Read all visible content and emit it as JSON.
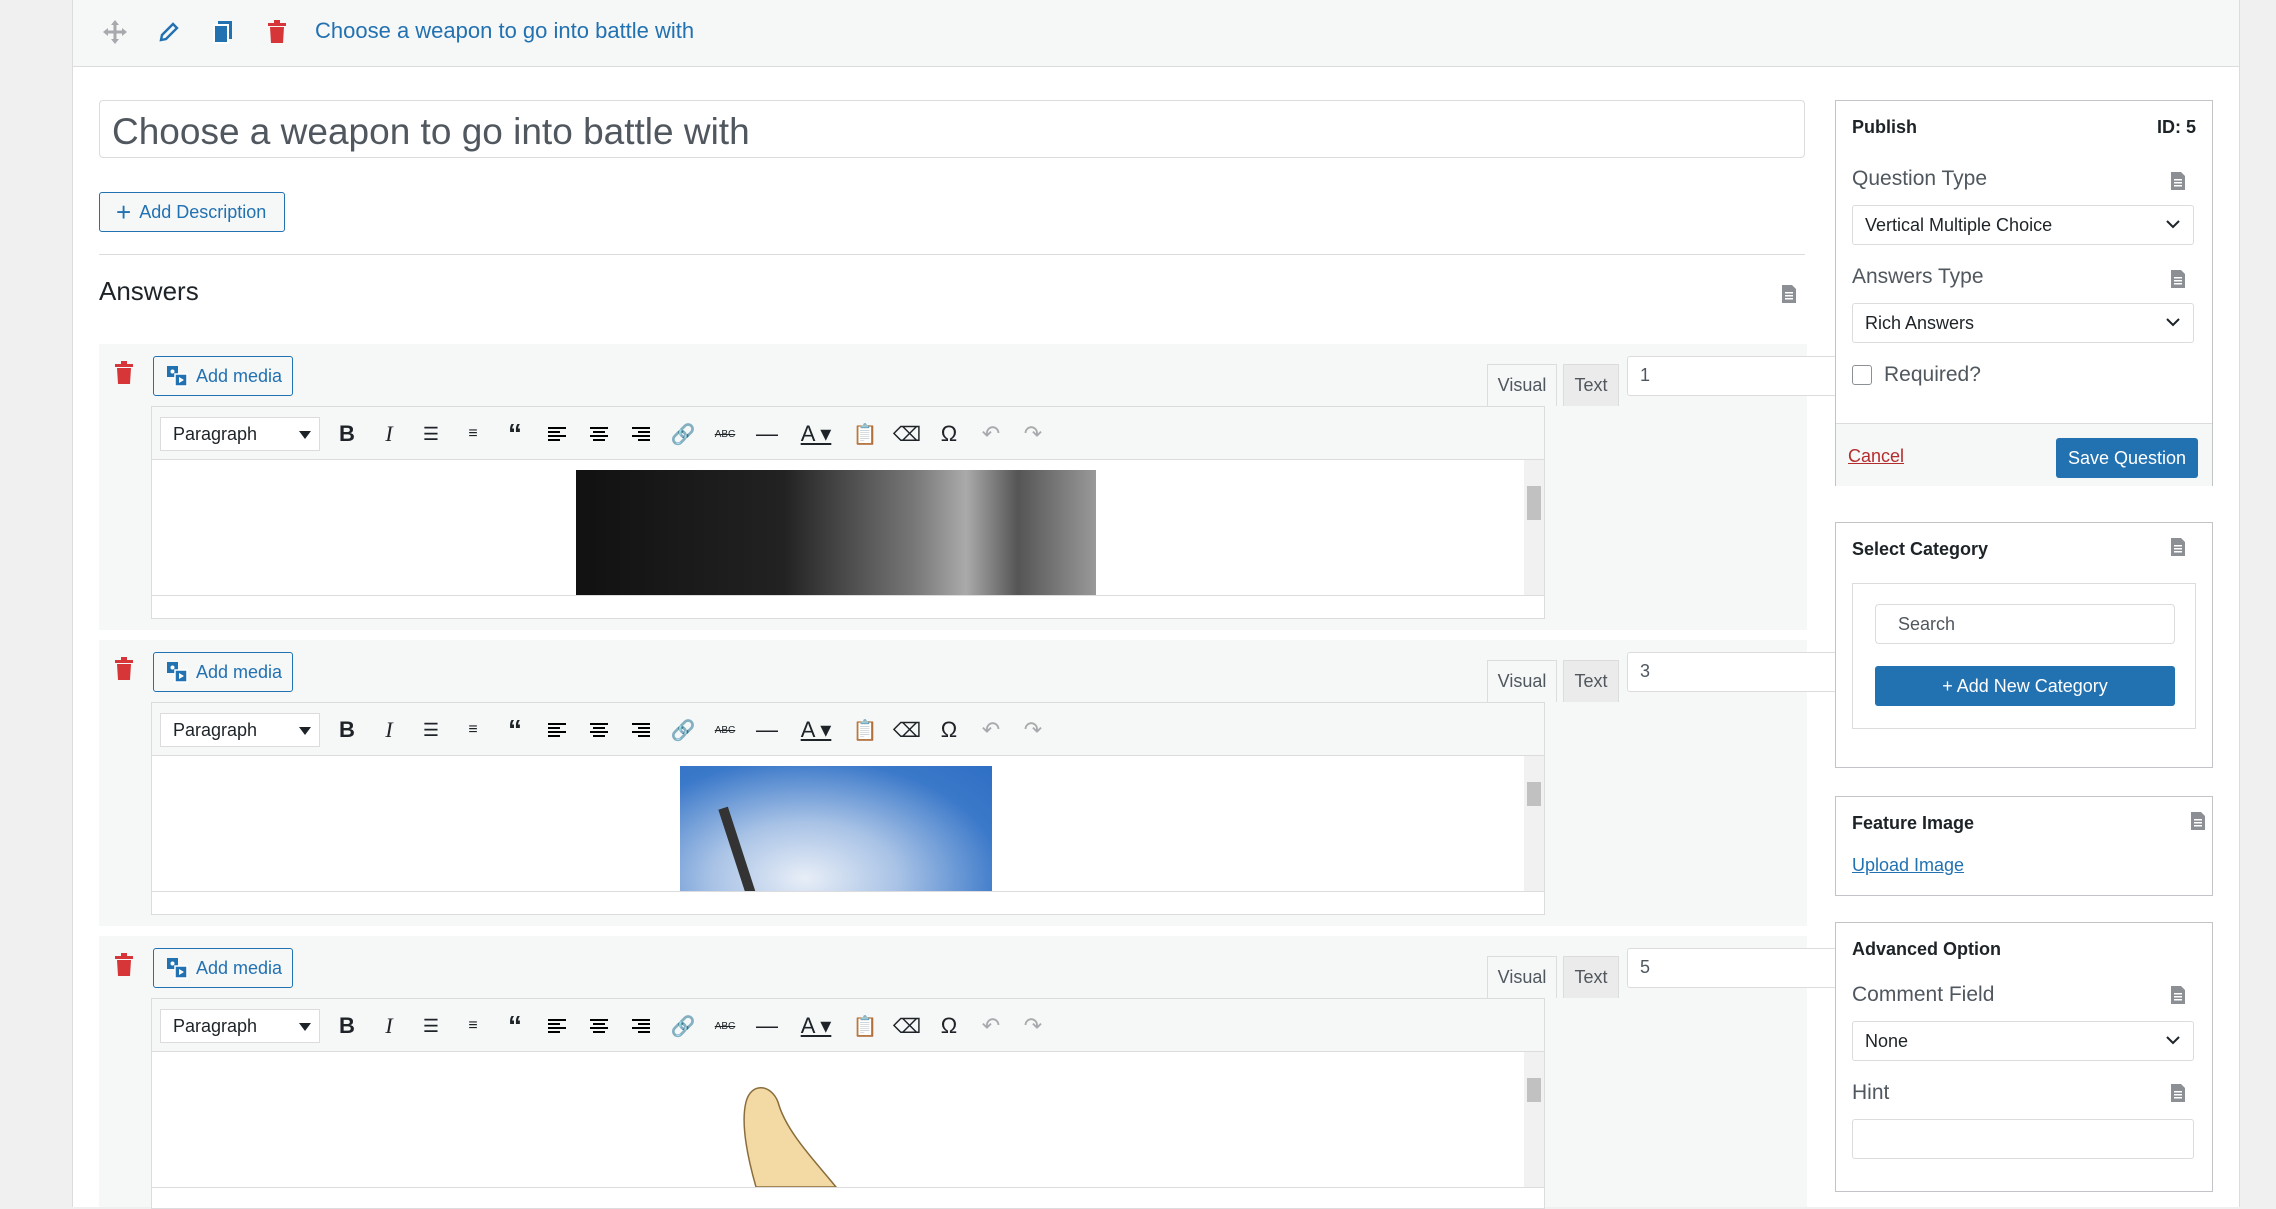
{
  "header": {
    "title": "Choose a weapon to go into battle with",
    "icons": [
      "move-icon",
      "edit-icon",
      "copy-icon",
      "delete-icon"
    ]
  },
  "question": {
    "title_value": "Choose a weapon to go into battle with",
    "add_description_label": "Add Description"
  },
  "answers": {
    "heading": "Answers",
    "add_media_label": "Add media",
    "tab_visual": "Visual",
    "tab_text": "Text",
    "paragraph_label": "Paragraph",
    "items": [
      {
        "value": "1",
        "image": "dark axe scene"
      },
      {
        "value": "3",
        "image": "blade against blue sky"
      },
      {
        "value": "5",
        "image": "hand-drawn weapon"
      }
    ]
  },
  "publish": {
    "heading": "Publish",
    "id_label": "ID: 5",
    "question_type_label": "Question Type",
    "question_type_value": "Vertical Multiple Choice",
    "answers_type_label": "Answers Type",
    "answers_type_value": "Rich Answers",
    "required_label": "Required?",
    "cancel_label": "Cancel",
    "save_label": "Save Question"
  },
  "category": {
    "heading": "Select Category",
    "search_placeholder": "Search",
    "add_new_label": "+ Add New Category"
  },
  "feature_image": {
    "heading": "Feature Image",
    "upload_label": "Upload Image"
  },
  "advanced": {
    "heading": "Advanced Option",
    "comment_label": "Comment Field",
    "comment_value": "None",
    "hint_label": "Hint"
  },
  "colors": {
    "accent": "#2271b1",
    "danger": "#d63638"
  }
}
